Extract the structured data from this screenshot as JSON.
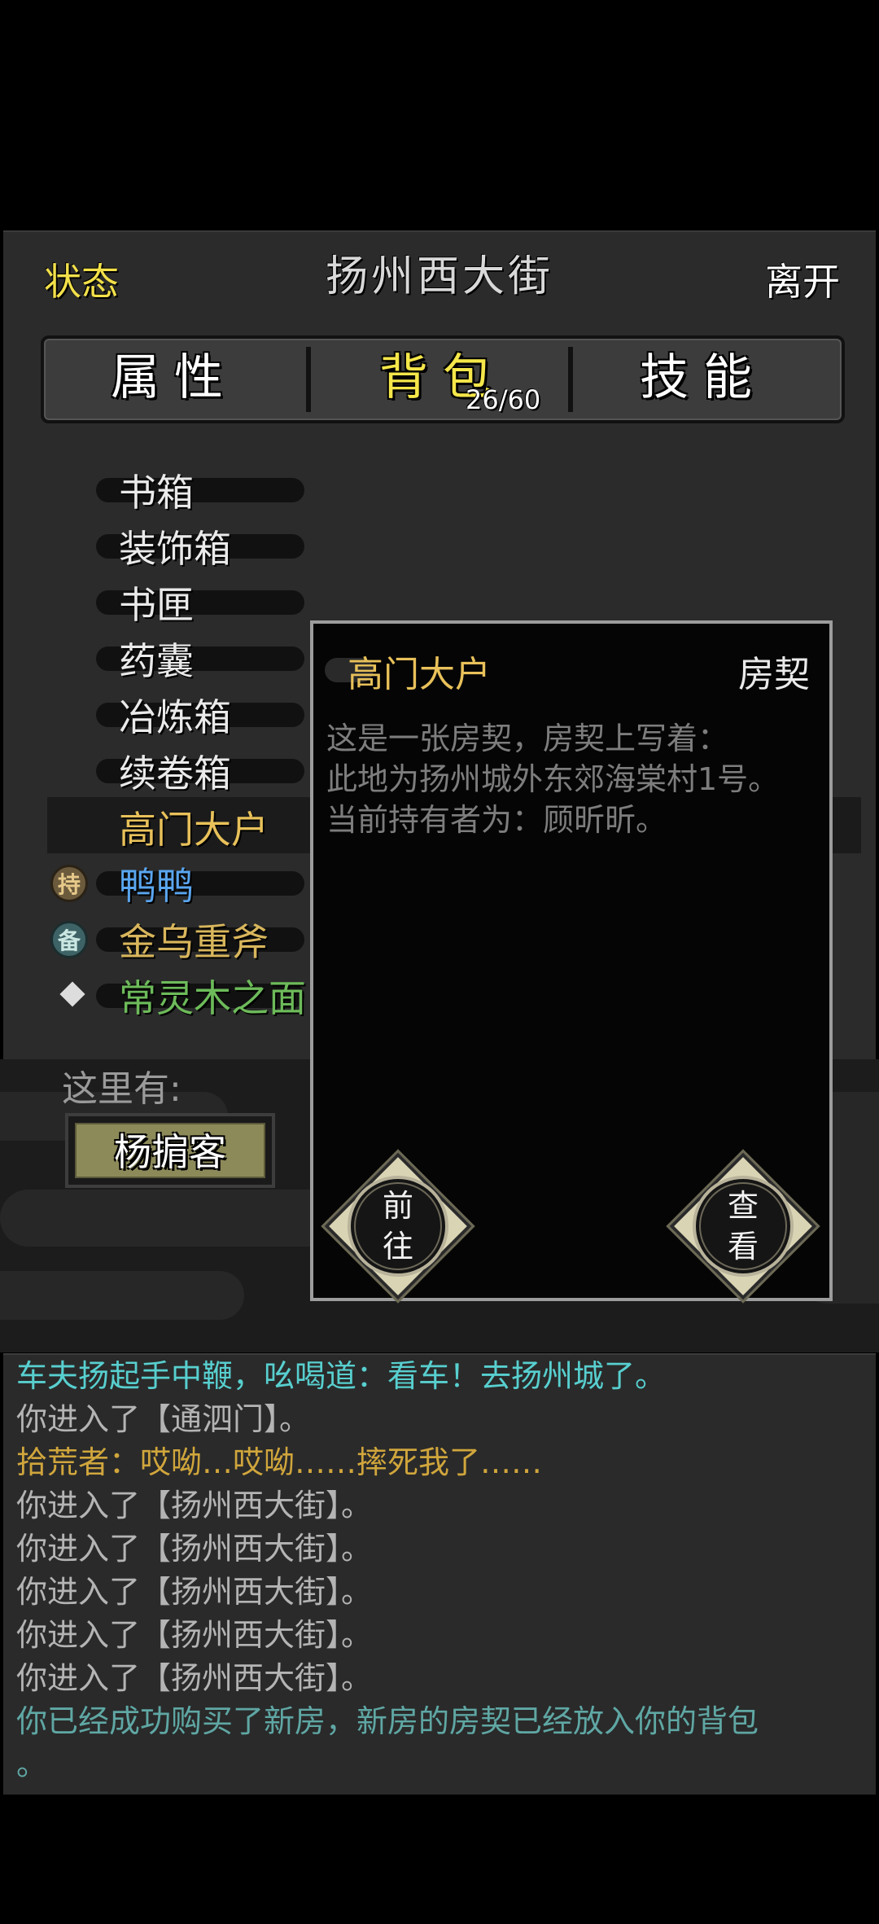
{
  "header": {
    "status_label": "状态",
    "location_title": "扬州西大街",
    "leave_label": "离开"
  },
  "tabs": [
    {
      "label": "属性"
    },
    {
      "label": "背包",
      "count": "26/60",
      "active": true
    },
    {
      "label": "技能"
    }
  ],
  "inventory": [
    {
      "name": "书箱"
    },
    {
      "name": "装饰箱"
    },
    {
      "name": "书匣"
    },
    {
      "name": "药囊"
    },
    {
      "name": "冶炼箱"
    },
    {
      "name": "续卷箱"
    },
    {
      "name": "高门大户",
      "selected": true
    },
    {
      "name": "鸭鸭",
      "badge": "持",
      "color": "#5aa6f0"
    },
    {
      "name": "金乌重斧",
      "badge": "备",
      "color": "#d8b65c"
    },
    {
      "name": "常灵木之面",
      "marker": "diamond",
      "color": "#6dbb5a"
    }
  ],
  "here": {
    "label": "这里有:",
    "npc": "杨掮客"
  },
  "popup": {
    "item_name": "高门大户",
    "item_type": "房契",
    "description": [
      "这是一张房契，房契上写着：",
      "此地为扬州城外东郊海棠村1号。",
      "当前持有者为：顾昕昕。"
    ],
    "buttons": {
      "go_line1": "前",
      "go_line2": "往",
      "view_line1": "查",
      "view_line2": "看"
    }
  },
  "log": [
    {
      "text": "车夫扬起手中鞭，吆喝道：看车！去扬州城了。",
      "color": "#58cfcf"
    },
    {
      "text": "你进入了【通泗门】。",
      "color": "#b4b4b4"
    },
    {
      "text": "拾荒者：哎呦…哎呦……摔死我了……",
      "color": "#d0a63c"
    },
    {
      "text": "你进入了【扬州西大街】。",
      "color": "#b4b4b4"
    },
    {
      "text": "你进入了【扬州西大街】。",
      "color": "#b4b4b4"
    },
    {
      "text": "你进入了【扬州西大街】。",
      "color": "#b4b4b4"
    },
    {
      "text": "你进入了【扬州西大街】。",
      "color": "#b4b4b4"
    },
    {
      "text": "你进入了【扬州西大街】。",
      "color": "#b4b4b4"
    },
    {
      "text": "你已经成功购买了新房，新房的房契已经放入你的背包",
      "color": "#5fa7a4"
    },
    {
      "text": "。",
      "color": "#5fa7a4"
    }
  ]
}
